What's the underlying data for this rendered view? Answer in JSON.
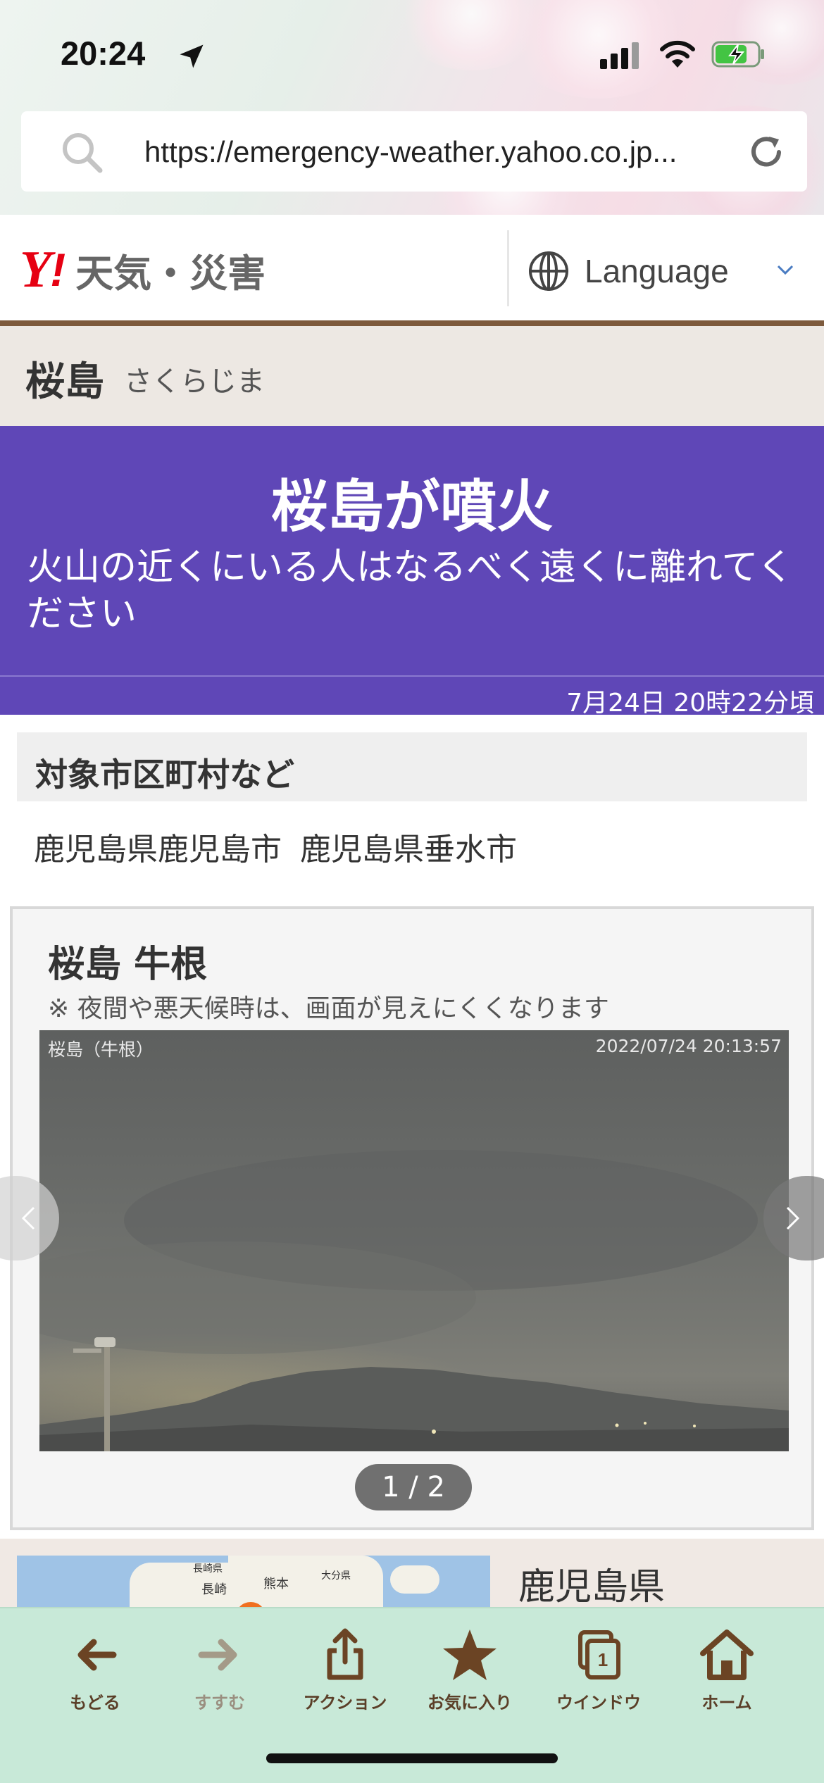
{
  "status_bar": {
    "time": "20:24"
  },
  "browser": {
    "url": "https://emergency-weather.yahoo.co.jp/weather/jp/volcano/...",
    "url_display": "https://emergency-weather.yahoo.co.jp..."
  },
  "site_header": {
    "logo_mark": "Y",
    "logo_exclaim": "!",
    "logo_text": "天気・災害",
    "language_label": "Language"
  },
  "place": {
    "name": "桜島",
    "reading": "さくらじま"
  },
  "alert": {
    "title": "桜島が噴火",
    "message": "火山の近くにいる人はなるべく遠くに離れてください",
    "timestamp": "7月24日 20時22分頃",
    "color": "#5f47b7"
  },
  "targets": {
    "heading": "対象市区町村など",
    "items": [
      "鹿児島県鹿児島市",
      "鹿児島県垂水市"
    ]
  },
  "camera": {
    "title": "桜島 牛根",
    "note": "※ 夜間や悪天候時は、画面が見えにくくなります",
    "overlay_location": "桜島（牛根）",
    "overlay_timestamp": "2022/07/24 20:13:57",
    "pager": "1 / 2"
  },
  "map_teaser": {
    "prefecture": "鹿児島県",
    "labels": [
      "長崎",
      "熊本",
      "大分県",
      "長崎県"
    ]
  },
  "toolbar": {
    "items": [
      {
        "label": "もどる",
        "icon": "back-arrow-icon",
        "enabled": true
      },
      {
        "label": "すすむ",
        "icon": "forward-arrow-icon",
        "enabled": false
      },
      {
        "label": "アクション",
        "icon": "share-icon",
        "enabled": true
      },
      {
        "label": "お気に入り",
        "icon": "star-icon",
        "enabled": true
      },
      {
        "label": "ウインドウ",
        "icon": "windows-icon",
        "enabled": true
      },
      {
        "label": "ホーム",
        "icon": "home-icon",
        "enabled": true
      }
    ],
    "window_count": "1"
  },
  "colors": {
    "brand_red": "#e60012",
    "header_rule": "#7d5a3c",
    "toolbar_bg": "#c8e9d8",
    "toolbar_text": "#5b3f28"
  }
}
